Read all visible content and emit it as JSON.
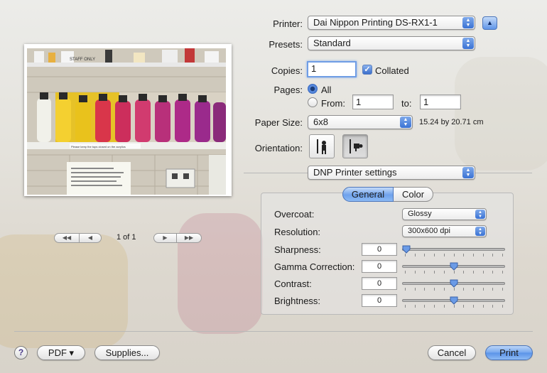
{
  "printer": {
    "label": "Printer:",
    "value": "Dai Nippon Printing  DS-RX1-1"
  },
  "presets": {
    "label": "Presets:",
    "value": "Standard"
  },
  "copies": {
    "label": "Copies:",
    "value": "1",
    "collated_label": "Collated",
    "collated": true
  },
  "pages": {
    "label": "Pages:",
    "all_label": "All",
    "from_label": "From:",
    "from_value": "1",
    "to_label": "to:",
    "to_value": "1",
    "selected": "all"
  },
  "paper_size": {
    "label": "Paper Size:",
    "value": "6x8",
    "dimensions": "15.24 by 20.71 cm"
  },
  "orientation": {
    "label": "Orientation:",
    "selected": "landscape"
  },
  "settings_menu": {
    "value": "DNP Printer settings"
  },
  "tabs": [
    {
      "label": "General",
      "selected": true
    },
    {
      "label": "Color",
      "selected": false
    }
  ],
  "general": {
    "overcoat": {
      "label": "Overcoat:",
      "value": "Glossy"
    },
    "resolution": {
      "label": "Resolution:",
      "value": "300x600 dpi"
    },
    "sharpness": {
      "label": "Sharpness:",
      "value": "0",
      "level": 0.0
    },
    "gamma": {
      "label": "Gamma Correction:",
      "value": "0",
      "level": 0.5
    },
    "contrast": {
      "label": "Contrast:",
      "value": "0",
      "level": 0.5
    },
    "brightness": {
      "label": "Brightness:",
      "value": "0",
      "level": 0.5
    }
  },
  "preview": {
    "page_indicator": "1 of 1",
    "photo_texts": {
      "sign_top": "STAFF ONLY",
      "sign_shelf": "Please keep the tops closed on the acrylics"
    }
  },
  "footer": {
    "help": "?",
    "pdf": "PDF ▾",
    "supplies": "Supplies...",
    "cancel": "Cancel",
    "print": "Print"
  },
  "colors": {
    "accent": "#5a92e8",
    "focus_ring": "#6f9de5"
  }
}
